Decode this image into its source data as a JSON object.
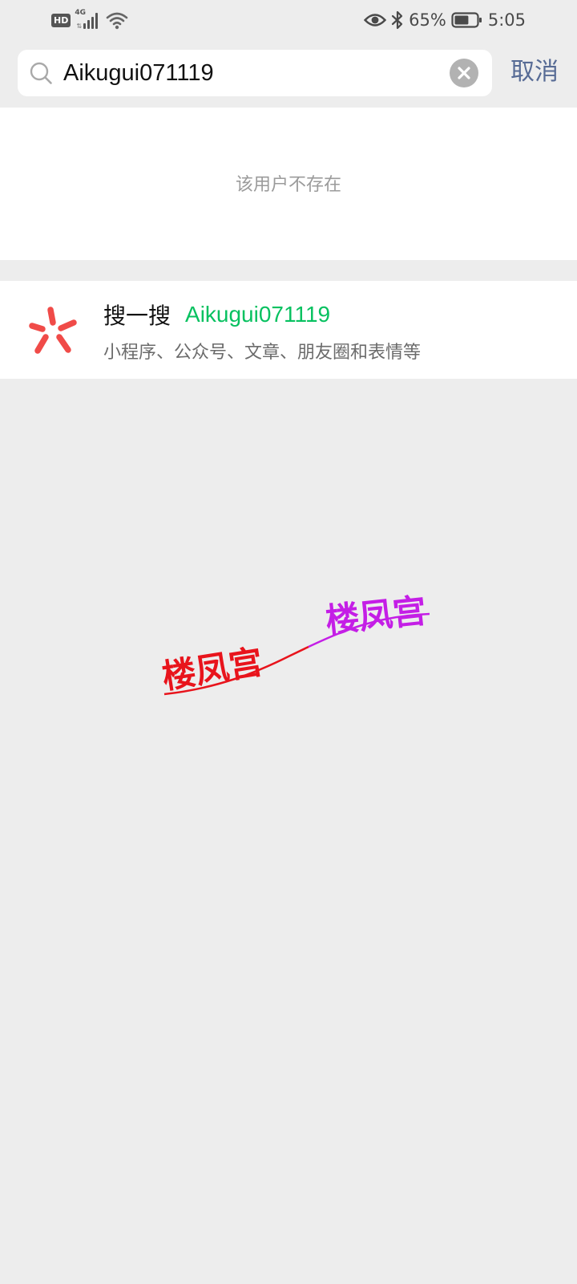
{
  "status_bar": {
    "hd_badge": "HD",
    "network": "4G",
    "battery_percent": "65%",
    "time": "5:05",
    "icons": [
      "hd-icon",
      "signal-icon",
      "wifi-icon",
      "eye-icon",
      "bluetooth-icon",
      "battery-icon"
    ],
    "battery_level": 0.65
  },
  "search": {
    "query": "Aikugui071119",
    "cancel_label": "取消"
  },
  "results": {
    "empty_message": "该用户不存在"
  },
  "sousou": {
    "label": "搜一搜",
    "keyword": "Aikugui071119",
    "subtitle": "小程序、公众号、文章、朋友圈和表情等",
    "icon": "sousou-icon"
  },
  "watermark": {
    "text_left": "楼凤宫",
    "text_right": "楼凤宫",
    "color_left": "#e8141c",
    "color_right": "#c41ee6"
  },
  "colors": {
    "background": "#ededed",
    "accent_green": "#07c160",
    "link_blue": "#576b95",
    "sousou_red": "#f04b48"
  }
}
